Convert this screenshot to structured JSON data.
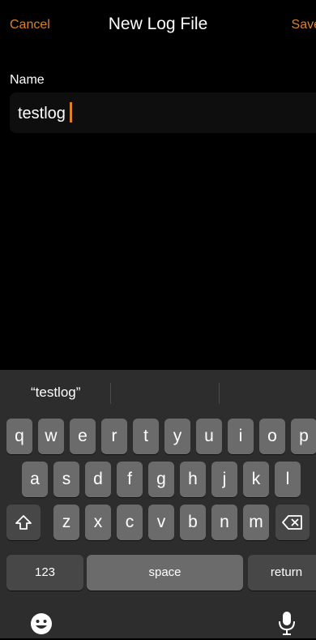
{
  "nav": {
    "cancel": "Cancel",
    "title": "New Log File",
    "save": "Save"
  },
  "form": {
    "name_label": "Name",
    "name_value": "testlog"
  },
  "keyboard": {
    "suggestions": [
      "“testlog”"
    ],
    "row1": [
      "q",
      "w",
      "e",
      "r",
      "t",
      "y",
      "u",
      "i",
      "o",
      "p"
    ],
    "row2": [
      "a",
      "s",
      "d",
      "f",
      "g",
      "h",
      "j",
      "k",
      "l"
    ],
    "row3": [
      "z",
      "x",
      "c",
      "v",
      "b",
      "n",
      "m"
    ],
    "numbers_key": "123",
    "space_key": "space",
    "return_key": "return",
    "shift_icon": "shift-icon",
    "delete_icon": "delete-icon",
    "emoji_icon": "emoji-icon",
    "mic_icon": "microphone-icon"
  },
  "colors": {
    "accent": "#d9822b",
    "background": "#000000",
    "keyboard_bg": "#2d2d2d",
    "key_bg": "#6b6b6b",
    "fn_key_bg": "#474747"
  }
}
